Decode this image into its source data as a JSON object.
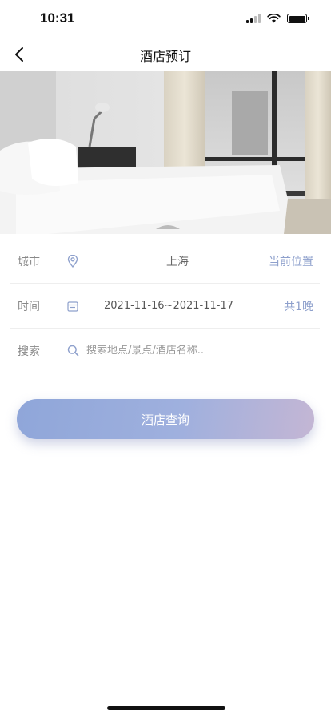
{
  "status_bar": {
    "time": "10:31"
  },
  "nav": {
    "title": "酒店预订"
  },
  "form": {
    "city": {
      "label": "城市",
      "value": "上海",
      "action": "当前位置"
    },
    "date": {
      "label": "时间",
      "value": "2021-11-16~2021-11-17",
      "nights": "共1晚"
    },
    "search": {
      "label": "搜索",
      "placeholder": "搜索地点/景点/酒店名称.."
    }
  },
  "query_button": {
    "label": "酒店查询"
  },
  "colors": {
    "accent": "#8ea0cc",
    "button_start": "#8fa6d9",
    "button_end": "#c4b6d4"
  }
}
